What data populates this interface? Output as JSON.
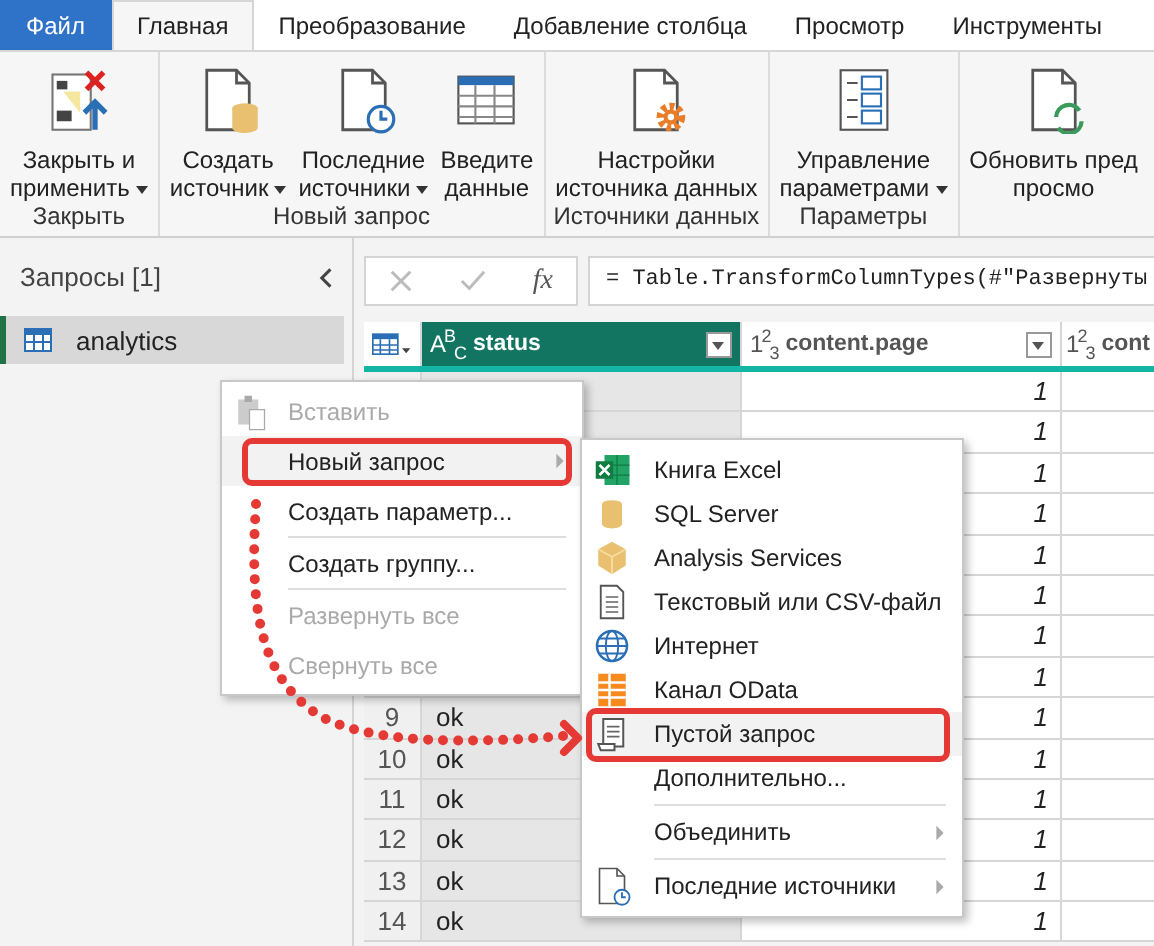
{
  "tabs": [
    {
      "label": "Файл",
      "kind": "file",
      "selected": false
    },
    {
      "label": "Главная",
      "kind": "tab",
      "selected": true
    },
    {
      "label": "Преобразование",
      "kind": "tab",
      "selected": false
    },
    {
      "label": "Добавление столбца",
      "kind": "tab",
      "selected": false
    },
    {
      "label": "Просмотр",
      "kind": "tab",
      "selected": false
    },
    {
      "label": "Инструменты",
      "kind": "tab",
      "selected": false
    }
  ],
  "ribbon": {
    "groups": [
      {
        "label": "Закрыть",
        "buttons": [
          {
            "label": "Закрыть и\nприменить",
            "kind": "closeapply",
            "dropdown": true
          }
        ]
      },
      {
        "label": "Новый запрос",
        "buttons": [
          {
            "label": "Создать\nисточник",
            "kind": "newsource",
            "dropdown": true
          },
          {
            "label": "Последние\nисточники",
            "kind": "recent",
            "dropdown": true
          },
          {
            "label": "Введите\nданные",
            "kind": "table",
            "dropdown": false
          }
        ]
      },
      {
        "label": "Источники данных",
        "buttons": [
          {
            "label": "Настройки\nисточника данных",
            "kind": "settings",
            "dropdown": false
          }
        ]
      },
      {
        "label": "Параметры",
        "buttons": [
          {
            "label": "Управление\nпараметрами",
            "kind": "params",
            "dropdown": true
          }
        ]
      },
      {
        "buttons": [
          {
            "label": "Обновить пред\nпросмо",
            "kind": "refresh",
            "dropdown": false
          }
        ]
      }
    ]
  },
  "queries_pane": {
    "title": "Запросы [1]",
    "items": [
      {
        "name": "analytics",
        "selected": true
      }
    ]
  },
  "formula_bar": {
    "fx": "fx",
    "formula": "= Table.TransformColumnTypes(#\"Развернуты"
  },
  "table": {
    "columns": [
      {
        "type": "A$^{B}$$_{C}$",
        "name": "status",
        "selected": true,
        "filter": true
      },
      {
        "type": "1$^{2}$$_{3}$",
        "name": "content.page",
        "selected": false,
        "filter": true
      },
      {
        "type": "1$^{2}$$_{3}$",
        "name": "cont",
        "selected": false
      }
    ],
    "rows": [
      {
        "content_page": "1"
      },
      {
        "content_page": "1"
      },
      {
        "content_page": "1"
      },
      {
        "content_page": "1"
      },
      {
        "content_page": "1"
      },
      {
        "content_page": "1"
      },
      {
        "content_page": "1"
      },
      {
        "content_page": "1"
      },
      {
        "number": "9",
        "status": "ok",
        "content_page": "1"
      },
      {
        "number": "10",
        "status": "ok",
        "content_page": "1"
      },
      {
        "number": "11",
        "status": "ok",
        "content_page": "1"
      },
      {
        "number": "12",
        "status": "ok",
        "content_page": "1"
      },
      {
        "number": "13",
        "status": "ok",
        "content_page": "1"
      },
      {
        "number": "14",
        "status": "ok",
        "content_page": "1"
      }
    ]
  },
  "context_menu": {
    "items": [
      {
        "kind": "paste",
        "label": "Вставить",
        "disabled": true,
        "highlighted": false,
        "submenu": false
      },
      {
        "kind": "item",
        "label": "Новый запрос",
        "disabled": false,
        "highlighted": true,
        "submenu": true
      },
      {
        "kind": "item",
        "label": "Создать параметр...",
        "disabled": false,
        "highlighted": false,
        "submenu": false
      },
      {
        "kind": "separator"
      },
      {
        "kind": "item",
        "label": "Создать группу...",
        "disabled": false,
        "highlighted": false,
        "submenu": false
      },
      {
        "kind": "separator"
      },
      {
        "kind": "item",
        "label": "Развернуть все",
        "disabled": true,
        "highlighted": false,
        "submenu": false
      },
      {
        "kind": "item",
        "label": "Свернуть все",
        "disabled": true,
        "highlighted": false,
        "submenu": false
      }
    ]
  },
  "submenu": {
    "items": [
      {
        "kind": "excel",
        "label": "Книга Excel",
        "highlighted": false,
        "submenu": false
      },
      {
        "kind": "database",
        "label": "SQL Server",
        "highlighted": false,
        "submenu": false
      },
      {
        "kind": "cube",
        "label": "Analysis Services",
        "highlighted": false,
        "submenu": false
      },
      {
        "kind": "textfile",
        "label": "Текстовый или CSV-файл",
        "highlighted": false,
        "submenu": false
      },
      {
        "kind": "globe",
        "label": "Интернет",
        "highlighted": false,
        "submenu": false
      },
      {
        "kind": "odata",
        "label": "Канал OData",
        "highlighted": false,
        "submenu": false
      },
      {
        "kind": "blank",
        "label": "Пустой запрос",
        "highlighted": true,
        "submenu": false
      },
      {
        "kind": "item",
        "label": "Дополнительно...",
        "highlighted": false,
        "submenu": false
      },
      {
        "kind": "separator"
      },
      {
        "kind": "item",
        "label": "Объединить",
        "highlighted": false,
        "submenu": true
      },
      {
        "kind": "separator"
      },
      {
        "kind": "recent",
        "label": "Последние источники",
        "highlighted": false,
        "submenu": true
      }
    ]
  }
}
